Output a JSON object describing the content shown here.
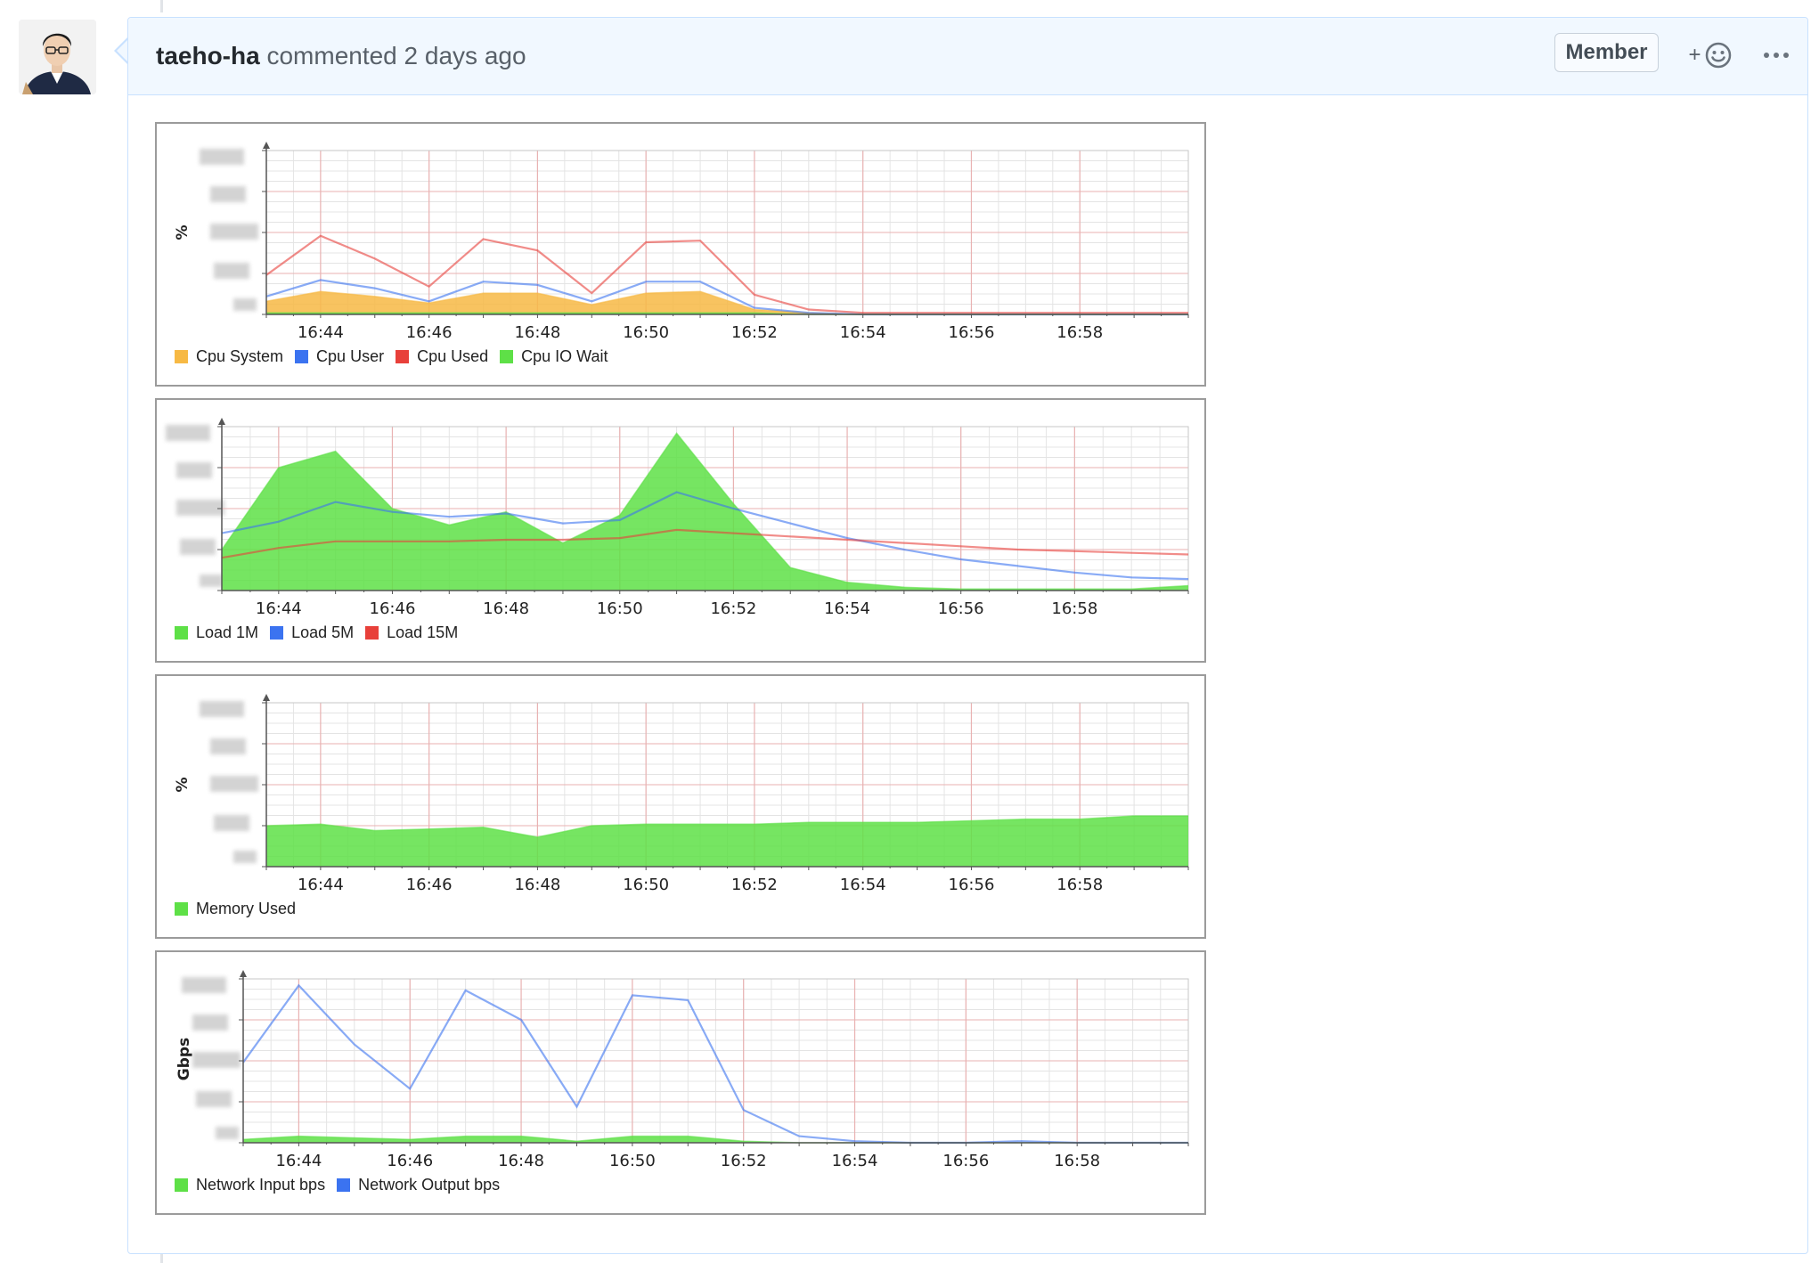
{
  "comment": {
    "author": "taeho-ha",
    "action": "commented",
    "time": "2 days ago",
    "badge": "Member",
    "react_plus": "+",
    "avatar_icon": "user-avatar-icon",
    "emoji_icon": "smiley-icon",
    "more_icon": "kebab-horizontal-icon"
  },
  "theme": {
    "header_bg": "#f1f8ff",
    "border": "#c8e1ff",
    "grid_minor": "#e2e2e2",
    "grid_major": "#e8a7a7"
  },
  "chart_data": [
    {
      "type": "area",
      "ylabel": "%",
      "x": [
        "16:43",
        "16:44",
        "16:45",
        "16:46",
        "16:47",
        "16:48",
        "16:49",
        "16:50",
        "16:51",
        "16:52",
        "16:53",
        "16:54",
        "16:55",
        "16:56",
        "16:57",
        "16:58",
        "16:59",
        "17:00"
      ],
      "xticks": [
        "16:44",
        "16:46",
        "16:48",
        "16:50",
        "16:52",
        "16:54",
        "16:56",
        "16:58"
      ],
      "ylim": [
        0,
        100
      ],
      "series": [
        {
          "name": "Cpu System",
          "color": "#f7b944",
          "style": "area",
          "values": [
            8,
            14,
            11,
            7,
            13,
            13,
            6,
            13,
            14,
            3,
            1,
            0,
            0,
            0,
            0,
            0,
            0,
            0
          ]
        },
        {
          "name": "Cpu User",
          "color": "#3b73f0",
          "style": "line",
          "values": [
            11,
            21,
            16,
            8,
            20,
            18,
            8,
            20,
            20,
            4,
            1,
            0,
            0,
            0,
            0,
            0,
            0,
            0
          ]
        },
        {
          "name": "Cpu Used",
          "color": "#e8403a",
          "style": "line",
          "values": [
            24,
            48,
            34,
            17,
            46,
            39,
            13,
            44,
            45,
            12,
            3,
            1,
            1,
            1,
            1,
            1,
            1,
            1
          ]
        },
        {
          "name": "Cpu IO Wait",
          "color": "#5ee047",
          "style": "area",
          "values": [
            1,
            1,
            1,
            1,
            1,
            1,
            1,
            1,
            1,
            1,
            0,
            0,
            0,
            0,
            0,
            0,
            0,
            0
          ]
        }
      ]
    },
    {
      "type": "area",
      "ylabel": "",
      "x": [
        "16:43",
        "16:44",
        "16:45",
        "16:46",
        "16:47",
        "16:48",
        "16:49",
        "16:50",
        "16:51",
        "16:52",
        "16:53",
        "16:54",
        "16:55",
        "16:56",
        "16:57",
        "16:58",
        "16:59",
        "17:00"
      ],
      "xticks": [
        "16:44",
        "16:46",
        "16:48",
        "16:50",
        "16:52",
        "16:54",
        "16:56",
        "16:58"
      ],
      "ylim": [
        0,
        100
      ],
      "series": [
        {
          "name": "Load 1M",
          "color": "#5ee047",
          "style": "area",
          "values": [
            25,
            75,
            85,
            50,
            40,
            48,
            29,
            46,
            96,
            53,
            14,
            5,
            2,
            1,
            1,
            1,
            1,
            3
          ]
        },
        {
          "name": "Load 5M",
          "color": "#3b73f0",
          "style": "line",
          "values": [
            35,
            42,
            54,
            48,
            45,
            47,
            41,
            43,
            60,
            50,
            41,
            32,
            25,
            19,
            15,
            11,
            8,
            7
          ]
        },
        {
          "name": "Load 15M",
          "color": "#e8403a",
          "style": "line",
          "values": [
            20,
            26,
            30,
            30,
            30,
            31,
            31,
            32,
            37,
            35,
            33,
            31,
            29,
            27,
            25,
            24,
            23,
            22
          ]
        }
      ]
    },
    {
      "type": "area",
      "ylabel": "%",
      "x": [
        "16:43",
        "16:44",
        "16:45",
        "16:46",
        "16:47",
        "16:48",
        "16:49",
        "16:50",
        "16:51",
        "16:52",
        "16:53",
        "16:54",
        "16:55",
        "16:56",
        "16:57",
        "16:58",
        "16:59",
        "17:00"
      ],
      "xticks": [
        "16:44",
        "16:46",
        "16:48",
        "16:50",
        "16:52",
        "16:54",
        "16:56",
        "16:58"
      ],
      "ylim": [
        0,
        100
      ],
      "series": [
        {
          "name": "Memory Used",
          "color": "#5ee047",
          "style": "area",
          "values": [
            25,
            26,
            22,
            23,
            24,
            18,
            25,
            26,
            26,
            26,
            27,
            27,
            27,
            28,
            29,
            29,
            31,
            31
          ]
        }
      ]
    },
    {
      "type": "line",
      "ylabel": "Gbps",
      "x": [
        "16:43",
        "16:44",
        "16:45",
        "16:46",
        "16:47",
        "16:48",
        "16:49",
        "16:50",
        "16:51",
        "16:52",
        "16:53",
        "16:54",
        "16:55",
        "16:56",
        "16:57",
        "16:58",
        "16:59",
        "17:00"
      ],
      "xticks": [
        "16:44",
        "16:46",
        "16:48",
        "16:50",
        "16:52",
        "16:54",
        "16:56",
        "16:58"
      ],
      "ylim": [
        0,
        100
      ],
      "series": [
        {
          "name": "Network Input bps",
          "color": "#5ee047",
          "style": "area",
          "values": [
            2,
            4,
            3,
            2,
            4,
            4,
            1,
            4,
            4,
            1,
            0,
            0,
            0,
            0,
            0,
            0,
            0,
            0
          ]
        },
        {
          "name": "Network Output bps",
          "color": "#3b73f0",
          "style": "line",
          "values": [
            49,
            96,
            60,
            33,
            93,
            75,
            22,
            90,
            87,
            20,
            4,
            1,
            0,
            0,
            1,
            0,
            0,
            0
          ]
        }
      ]
    }
  ]
}
